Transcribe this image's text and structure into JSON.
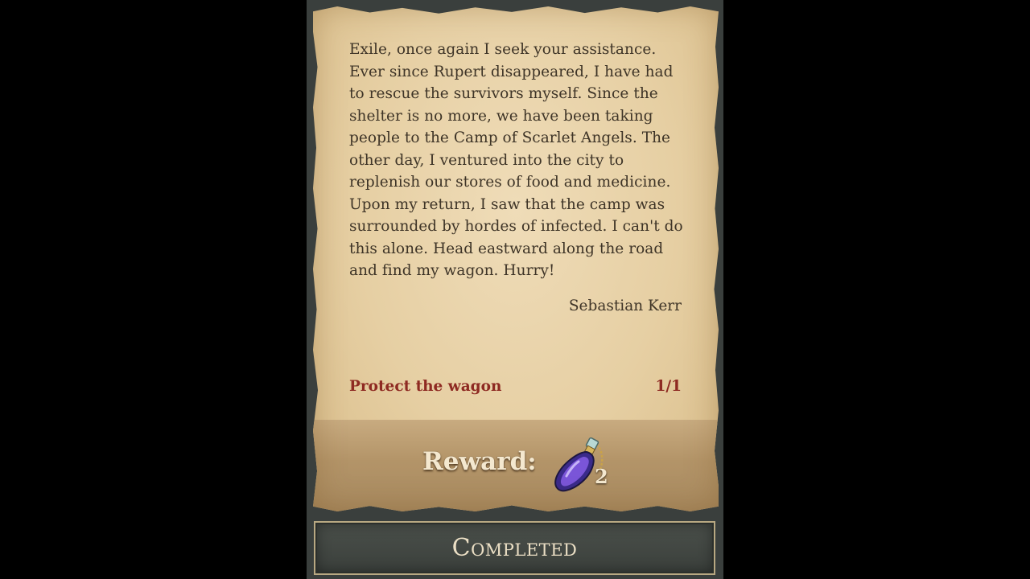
{
  "letter": {
    "body": "Exile, once again I seek your assistance. Ever since Rupert disappeared, I have had to rescue the survivors myself. Since the shelter is no more, we have been taking people to the Camp of Scarlet Angels. The other day, I ventured into the city to replenish our stores of food and medicine. Upon my return, I saw that the camp was surrounded by hordes of infected. I can't do this alone. Head eastward along the road and find my wagon. Hurry!",
    "signature": "Sebastian Kerr"
  },
  "objective": {
    "label": "Protect the wagon",
    "progress": "1/1"
  },
  "reward": {
    "label": "Reward:",
    "item_icon": "purple-potion-flask-icon",
    "count": "2"
  },
  "action": {
    "label": "Completed"
  },
  "colors": {
    "objective_text": "#8e2a22",
    "potion": "#5a3fb0",
    "frame": "#3a3f3d"
  }
}
